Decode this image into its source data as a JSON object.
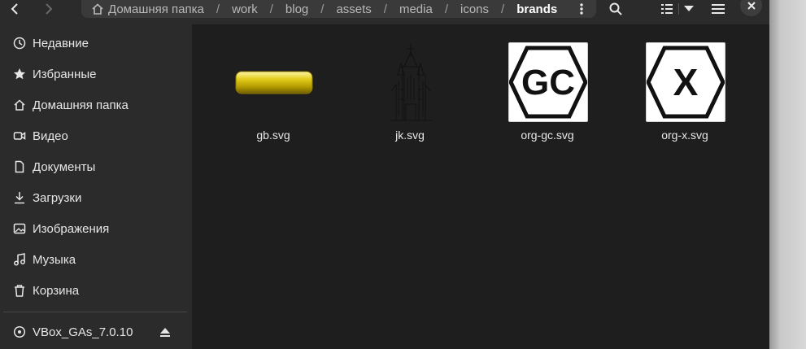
{
  "path": {
    "home_label": "Домашняя папка",
    "crumbs": [
      "work",
      "blog",
      "assets",
      "media",
      "icons"
    ],
    "current": "brands",
    "separator": "/"
  },
  "sidebar": {
    "items": [
      {
        "label": "Недавние",
        "icon": "clock-icon"
      },
      {
        "label": "Избранные",
        "icon": "star-icon"
      },
      {
        "label": "Домашняя папка",
        "icon": "home-icon"
      },
      {
        "label": "Видео",
        "icon": "video-icon"
      },
      {
        "label": "Документы",
        "icon": "document-icon"
      },
      {
        "label": "Загрузки",
        "icon": "download-icon"
      },
      {
        "label": "Изображения",
        "icon": "image-icon"
      },
      {
        "label": "Музыка",
        "icon": "music-icon"
      },
      {
        "label": "Корзина",
        "icon": "trash-icon"
      }
    ],
    "device": {
      "label": "VBox_GAs_7.0.10",
      "icon": "disc-icon"
    }
  },
  "files": [
    {
      "name": "gb.svg"
    },
    {
      "name": "jk.svg"
    },
    {
      "name": "org-gc.svg",
      "logo_text": "GC"
    },
    {
      "name": "org-x.svg",
      "logo_text": "X"
    }
  ],
  "colors": {
    "window_bg": "#1e1e1e",
    "sidebar_bg": "#2b2b2b",
    "pathbar_bg": "#3a3a3a",
    "gold": "#c9b000"
  }
}
